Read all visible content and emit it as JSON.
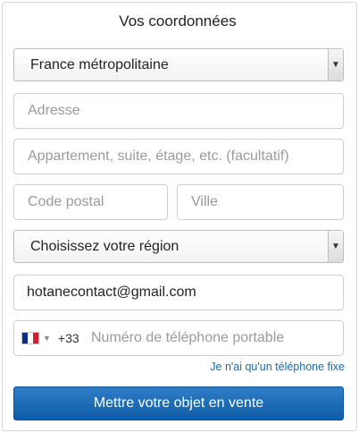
{
  "form": {
    "title": "Vos coordonnées",
    "country_select": {
      "value": "France métropolitaine",
      "icon": "chevron-down-icon"
    },
    "address": {
      "placeholder": "Adresse",
      "value": ""
    },
    "address2": {
      "placeholder": "Appartement, suite, étage, etc. (facultatif)",
      "value": ""
    },
    "postal_code": {
      "placeholder": "Code postal",
      "value": ""
    },
    "city": {
      "placeholder": "Ville",
      "value": ""
    },
    "region_select": {
      "value": "Choisissez votre région",
      "icon": "chevron-down-icon"
    },
    "email": {
      "value": "hotanecontact@gmail.com"
    },
    "phone": {
      "flag_icon": "france-flag-icon",
      "flag_colors": [
        "#0b2e8a",
        "#ffffff",
        "#d11f2b"
      ],
      "dial_code": "+33",
      "placeholder": "Numéro de téléphone portable"
    },
    "landline_link": "Je n'ai qu'un téléphone fixe",
    "submit_label": "Mettre votre objet en vente"
  },
  "colors": {
    "link": "#1a6bb0",
    "button": "#1565b5",
    "border": "#cfcfcf"
  }
}
